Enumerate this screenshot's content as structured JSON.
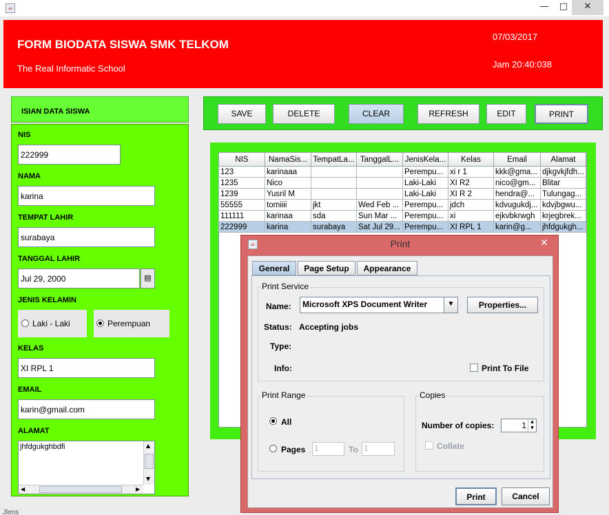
{
  "window": {
    "icon": "java-icon",
    "controls": [
      "—",
      "□",
      "✕"
    ]
  },
  "header": {
    "title": "FORM BIODATA SISWA SMK TELKOM",
    "subtitle": "The Real Informatic School",
    "date": "07/03/2017",
    "time": "Jam 20:40:038",
    "bg_color": "#ff0000"
  },
  "form": {
    "heading": "ISIAN DATA SISWA",
    "nis_label": "NIS",
    "nis_value": "222999",
    "nama_label": "NAMA",
    "nama_value": "karina",
    "tempat_label": "TEMPAT LAHIR",
    "tempat_value": "surabaya",
    "tanggal_label": "TANGGAL LAHIR",
    "tanggal_value": "Jul 29, 2000",
    "jk_label": "JENIS KELAMIN",
    "jk_options": [
      "Laki - Laki",
      "Perempuan"
    ],
    "jk_selected": "Perempuan",
    "kelas_label": "KELAS",
    "kelas_value": "XI RPL 1",
    "email_label": "EMAIL",
    "email_value": "karin@gmail.com",
    "alamat_label": "ALAMAT",
    "alamat_value": "jhfdgukghbdfi",
    "panel_color": "#66ff00"
  },
  "toolbar": {
    "save": "SAVE",
    "delete": "DELETE",
    "clear": "CLEAR",
    "refresh": "REFRESH",
    "edit": "EDIT",
    "print": "PRINT"
  },
  "table": {
    "columns": [
      "NIS",
      "NamaSis...",
      "TempatLa...",
      "TanggalL...",
      "JenisKela...",
      "Kelas",
      "Email",
      "Alamat"
    ],
    "rows": [
      [
        "123",
        "karinaaa",
        "",
        "",
        "Perempu...",
        "xi r 1",
        "kkk@gma...",
        "djkgvkjfdh..."
      ],
      [
        "1235",
        "Nico",
        "",
        "",
        "Laki-Laki",
        "XI R2",
        "nico@gm...",
        "Blitar"
      ],
      [
        "1239",
        "Yusril M",
        "",
        "",
        "Laki-Laki",
        "XI R 2",
        "hendra@...",
        "Tulungag..."
      ],
      [
        "55555",
        "tomiiii",
        "jkt",
        "Wed Feb ...",
        "Perempu...",
        "jdch",
        "kdvugukdj...",
        "kdvjbgwu..."
      ],
      [
        "111111",
        "karinaa",
        "sda",
        "Sun Mar ...",
        "Perempu...",
        "xi",
        "ejkvbkrwgh",
        "krjegbrek..."
      ],
      [
        "222999",
        "karina",
        "surabaya",
        "Sat Jul 29...",
        "Perempu...",
        "XI RPL 1",
        "karin@g...",
        "jhfdgukgh..."
      ]
    ],
    "selected_row": 5
  },
  "print_dialog": {
    "title": "Print",
    "tabs": [
      "General",
      "Page Setup",
      "Appearance"
    ],
    "active_tab": "General",
    "service_group": "Print Service",
    "name_label": "Name:",
    "printer": "Microsoft XPS Document Writer",
    "properties_button": "Properties...",
    "status_label": "Status:",
    "status_value": "Accepting jobs",
    "type_label": "Type:",
    "info_label": "Info:",
    "print_to_file": "Print To File",
    "range_group": "Print Range",
    "range_all": "All",
    "range_pages": "Pages",
    "pages_from": "1",
    "pages_to_label": "To",
    "pages_to": "1",
    "copies_group": "Copies",
    "copies_label": "Number of copies:",
    "copies_value": "1",
    "collate": "Collate",
    "print_button": "Print",
    "cancel_button": "Cancel"
  },
  "status_text": "Jlens"
}
